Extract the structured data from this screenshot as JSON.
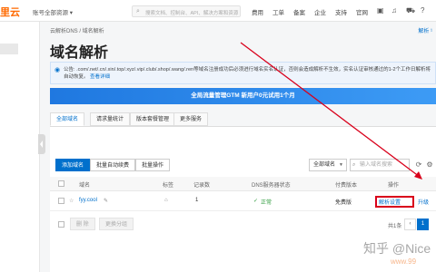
{
  "topbar": {
    "logo": "里云",
    "account": "账号全部资源 ▾",
    "search_placeholder": "搜索文档、控制台、API、解决方案和资源",
    "nav": [
      "费用",
      "工单",
      "备案",
      "企业",
      "支持",
      "官网"
    ],
    "icons": [
      "terminal-icon",
      "bell-icon",
      "cart-icon",
      "help-icon"
    ]
  },
  "breadcrumb": "云解析DNS / 域名解析",
  "breadcrumb_right": "解析 ¹",
  "page_title": "域名解析",
  "notice": {
    "label": "公告:",
    "text": ".com/.net/.cn/.xin/.top/.xyz/.vip/.club/.shop/.wang/.ren等域名注册成功后必须进行域名实名认证，否则会造成解析不生效，实名认证审核通过的1-2个工作日解析将自动恢复。",
    "link": "查看详细"
  },
  "banner": "全局流量管理GTM 新用户0元试用1个月",
  "tabs": [
    "全部域名",
    "请求量统计",
    "版本套餐管理",
    "更多服务"
  ],
  "active_tab": 0,
  "toolbar": {
    "add_domain": "添加域名",
    "batch_renew": "批量自动续费",
    "batch_ops": "批量操作",
    "group_select": "全部域名",
    "search_placeholder": "输入域名搜索",
    "tool_icons": [
      "refresh-icon",
      "settings-icon"
    ]
  },
  "table": {
    "columns": [
      "域名",
      "标签",
      "记录数",
      "DNS服务器状态",
      "付费版本",
      "操作"
    ],
    "rows": [
      {
        "domain": "fyy.cool",
        "tag_icon": "tag-icon",
        "records": "1",
        "dns_status": "正常",
        "plan": "免费版",
        "action_primary": "解析设置",
        "action_secondary": "升级"
      }
    ]
  },
  "footer": {
    "delete_btn": "删 除",
    "group_btn": "更换分组",
    "total": "共1条",
    "page": "1"
  },
  "watermark": "知乎 @Nice",
  "watermark_url": "www.99"
}
